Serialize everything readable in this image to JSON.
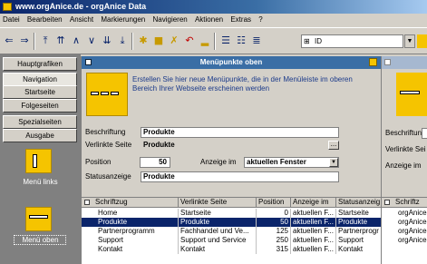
{
  "window": {
    "title": "www.orgAnice.de - orgAnice Data"
  },
  "menu": [
    "Datei",
    "Bearbeiten",
    "Ansicht",
    "Markierungen",
    "Navigieren",
    "Aktionen",
    "Extras",
    "?"
  ],
  "toolbar": {
    "id_field_value": "ID"
  },
  "sidebar": {
    "buttons": [
      "Hauptgrafiken",
      "Navigation",
      "Startseite",
      "Folgeseiten",
      "Spezialseiten",
      "Ausgabe"
    ],
    "active_index": 1,
    "icons": [
      {
        "label": "Menü links",
        "icon": "menu-links-icon"
      },
      {
        "label": "Menü oben",
        "icon": "menu-oben-icon"
      }
    ]
  },
  "panel": {
    "title": "Menüpunkte oben",
    "description": "Erstellen Sie hier neue Menüpunkte, die in der Menüleiste im oberen Bereich Ihrer Webseite erscheinen werden",
    "labels": {
      "caption": "Beschriftung",
      "linked_page": "Verlinkte Seite",
      "position": "Position",
      "display_in": "Anzeige im",
      "status": "Statusanzeige"
    },
    "values": {
      "caption": "Produkte",
      "linked_page": "Produkte",
      "position": "50",
      "display_in": "aktuellen Fenster",
      "status": "Produkte"
    },
    "browse_button": "...",
    "table": {
      "headers": [
        "Schriftzug",
        "Verlinkte Seite",
        "Position",
        "Anzeige im",
        "Statusanzeig"
      ],
      "rows": [
        [
          "Home",
          "Startseite",
          "0",
          "aktuellen F...",
          "Startseite"
        ],
        [
          "Produkte",
          "Produkte",
          "50",
          "aktuellen F...",
          "Produkte"
        ],
        [
          "Partnerprogramm",
          "Fachhandel und Ve...",
          "125",
          "aktuellen F...",
          "Partnerprogr"
        ],
        [
          "Support",
          "Support und Service",
          "250",
          "aktuellen F...",
          "Support"
        ],
        [
          "Kontakt",
          "Kontakt",
          "315",
          "aktuellen F...",
          "Kontakt"
        ]
      ],
      "selected_row": 1
    }
  },
  "panel2": {
    "labels": [
      "Beschriftung",
      "Verlinkte Sei",
      "Anzeige im"
    ],
    "table_header": "Schriftz",
    "rows": [
      "orgAnice",
      "orgAnice",
      "orgAnice",
      "orgAnice"
    ]
  }
}
